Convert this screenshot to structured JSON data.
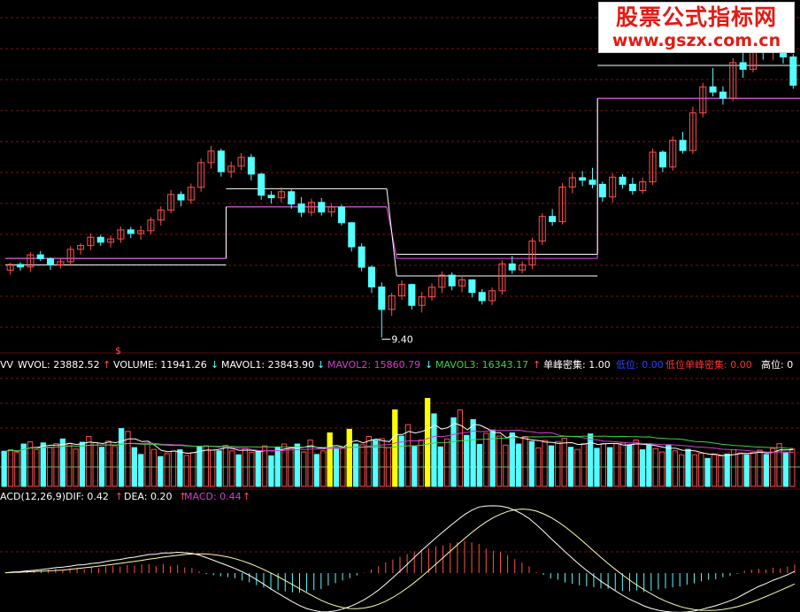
{
  "watermark": {
    "title": "股票公式指标网",
    "url": "www.gszx.com.cn"
  },
  "colors": {
    "up": "#ff5050",
    "down": "#54ffff",
    "grid": "#7a1010",
    "ref": "#cc2020",
    "white": "#ffffff",
    "magenta": "#d040d0",
    "yellow": "#ffff00",
    "green": "#40d040"
  },
  "main_panel": {
    "low_label": "9.40",
    "dollar": "$",
    "bands": [
      {
        "from": 0,
        "to": 21,
        "upper": 12.28,
        "middle": 12.28,
        "lower": 12.04
      },
      {
        "from": 22,
        "to": 37,
        "upper": 14.82,
        "middle": 14.16,
        "lower": 14.16
      },
      {
        "from": 39,
        "to": 58,
        "upper": 12.43,
        "middle": 12.28,
        "lower": 11.64
      },
      {
        "from": 59,
        "to": 80,
        "upper": 19.31,
        "middle": 18.11,
        "lower": 18.11
      },
      {
        "from": 81,
        "to": 89,
        "upper": 17.93,
        "middle": 17.67,
        "lower": 16.6
      }
    ]
  },
  "volume_header": {
    "prefix": "VV",
    "items": [
      {
        "label": "WVOL: 23882.52",
        "arrow": "↑",
        "color": "#ffffff",
        "arrowColor": "#ff5050"
      },
      {
        "label": "VOLUME: 11941.26",
        "arrow": "↓",
        "color": "#ffffff",
        "arrowColor": "#54ffff"
      },
      {
        "label": "MAVOL1: 23843.90",
        "arrow": "↓",
        "color": "#ffffff",
        "arrowColor": "#54ffff"
      },
      {
        "label": "MAVOL2: 15860.79",
        "arrow": "↓",
        "color": "#d040d0",
        "arrowColor": "#54ffff"
      },
      {
        "label": "MAVOL3: 16343.17",
        "arrow": "↑",
        "color": "#40d040",
        "arrowColor": "#ff5050"
      },
      {
        "label": "单峰密集: 1.00",
        "arrow": "",
        "color": "#ffffff",
        "arrowColor": ""
      },
      {
        "label": "低位: 0.00",
        "arrow": "",
        "color": "#3040ff",
        "arrowColor": ""
      },
      {
        "label": "低位单峰密集: 0.00",
        "arrow": "",
        "color": "#ff3030",
        "arrowColor": ""
      },
      {
        "label": "高位: 0",
        "arrow": "",
        "color": "#ffffff",
        "arrowColor": ""
      }
    ]
  },
  "macd_header": {
    "prefix": "ACD(12,26,9)",
    "items": [
      {
        "label": "DIF: 0.42",
        "arrow": "↑",
        "color": "#ffffff",
        "arrowColor": "#ff5050"
      },
      {
        "label": "DEA: 0.20",
        "arrow": "↑",
        "color": "#ffffff",
        "arrowColor": "#ff5050"
      },
      {
        "label": "MACD: 0.44",
        "arrow": "↑",
        "color": "#d040d0",
        "arrowColor": "#ff5050"
      }
    ]
  },
  "chart_data": [
    {
      "type": "candlestick",
      "title": "",
      "price_range": [
        9.0,
        21.5
      ],
      "fields": [
        "open",
        "high",
        "low",
        "close"
      ],
      "ohlc": [
        [
          11.85,
          12.12,
          11.69,
          12.06
        ],
        [
          12.06,
          12.14,
          11.83,
          11.97
        ],
        [
          11.97,
          12.51,
          11.78,
          12.41
        ],
        [
          12.41,
          12.55,
          12.18,
          12.27
        ],
        [
          12.27,
          12.32,
          11.86,
          12.05
        ],
        [
          12.05,
          12.27,
          11.91,
          12.16
        ],
        [
          12.16,
          12.73,
          12.02,
          12.61
        ],
        [
          12.61,
          12.84,
          12.42,
          12.75
        ],
        [
          12.75,
          13.19,
          12.58,
          13.05
        ],
        [
          13.05,
          13.14,
          12.74,
          12.87
        ],
        [
          12.87,
          13.12,
          12.68,
          12.99
        ],
        [
          12.99,
          13.44,
          12.85,
          13.32
        ],
        [
          13.32,
          13.43,
          13.02,
          13.19
        ],
        [
          13.19,
          13.47,
          12.96,
          13.29
        ],
        [
          13.29,
          13.78,
          13.16,
          13.68
        ],
        [
          13.68,
          14.18,
          13.48,
          14.04
        ],
        [
          14.04,
          14.78,
          13.92,
          14.61
        ],
        [
          14.61,
          14.72,
          14.18,
          14.41
        ],
        [
          14.41,
          15.01,
          14.27,
          14.87
        ],
        [
          14.87,
          15.92,
          14.71,
          15.77
        ],
        [
          15.77,
          16.38,
          15.55,
          16.19
        ],
        [
          16.19,
          16.28,
          15.26,
          15.44
        ],
        [
          15.44,
          15.81,
          15.22,
          15.64
        ],
        [
          15.64,
          16.12,
          15.49,
          15.96
        ],
        [
          15.96,
          16.08,
          15.12,
          15.35
        ],
        [
          15.35,
          15.39,
          14.42,
          14.58
        ],
        [
          14.58,
          14.73,
          14.28,
          14.49
        ],
        [
          14.49,
          14.87,
          14.32,
          14.71
        ],
        [
          14.71,
          14.79,
          14.09,
          14.26
        ],
        [
          14.26,
          14.51,
          13.79,
          13.96
        ],
        [
          13.96,
          14.46,
          13.82,
          14.32
        ],
        [
          14.32,
          14.48,
          13.84,
          13.97
        ],
        [
          13.97,
          14.28,
          13.8,
          14.15
        ],
        [
          14.15,
          14.24,
          13.48,
          13.58
        ],
        [
          13.58,
          13.6,
          12.53,
          12.7
        ],
        [
          12.7,
          12.83,
          11.81,
          11.96
        ],
        [
          11.96,
          12.03,
          11.02,
          11.24
        ],
        [
          11.24,
          11.41,
          9.4,
          10.42
        ],
        [
          10.42,
          11.03,
          10.19,
          10.92
        ],
        [
          10.92,
          11.48,
          10.77,
          11.33
        ],
        [
          11.33,
          11.36,
          10.42,
          10.57
        ],
        [
          10.57,
          11.06,
          10.31,
          10.88
        ],
        [
          10.88,
          11.37,
          10.74,
          11.23
        ],
        [
          11.23,
          11.81,
          11.02,
          11.67
        ],
        [
          11.67,
          11.77,
          11.12,
          11.28
        ],
        [
          11.28,
          11.64,
          11.05,
          11.5
        ],
        [
          11.5,
          11.52,
          10.86,
          11.04
        ],
        [
          11.04,
          11.16,
          10.6,
          10.74
        ],
        [
          10.74,
          11.22,
          10.58,
          11.1
        ],
        [
          11.1,
          12.21,
          10.96,
          12.08
        ],
        [
          12.08,
          12.37,
          11.72,
          11.86
        ],
        [
          11.86,
          12.18,
          11.74,
          12.04
        ],
        [
          12.04,
          13.03,
          11.89,
          12.91
        ],
        [
          12.91,
          13.93,
          12.77,
          13.81
        ],
        [
          13.81,
          14.08,
          13.47,
          13.62
        ],
        [
          13.62,
          15.02,
          13.52,
          14.88
        ],
        [
          14.88,
          15.42,
          14.65,
          15.22
        ],
        [
          15.22,
          15.46,
          14.91,
          15.13
        ],
        [
          15.13,
          15.58,
          14.83,
          14.98
        ],
        [
          14.98,
          15.08,
          14.34,
          14.52
        ],
        [
          14.52,
          15.38,
          14.32,
          15.24
        ],
        [
          15.24,
          15.35,
          14.82,
          14.98
        ],
        [
          14.98,
          15.22,
          14.6,
          14.75
        ],
        [
          14.75,
          15.22,
          14.63,
          15.07
        ],
        [
          15.07,
          16.28,
          14.96,
          16.15
        ],
        [
          16.15,
          16.22,
          15.42,
          15.61
        ],
        [
          15.61,
          16.72,
          15.48,
          16.58
        ],
        [
          16.58,
          16.89,
          16.1,
          16.21
        ],
        [
          16.21,
          17.81,
          16.08,
          17.58
        ],
        [
          17.58,
          18.68,
          17.42,
          18.53
        ],
        [
          18.53,
          19.22,
          18.18,
          18.34
        ],
        [
          18.34,
          18.55,
          17.88,
          18.12
        ],
        [
          18.12,
          19.58,
          18.01,
          19.41
        ],
        [
          19.41,
          19.85,
          18.86,
          19.17
        ],
        [
          19.17,
          21.14,
          19.06,
          20.92
        ],
        [
          20.92,
          21.22,
          19.52,
          19.81
        ],
        [
          19.81,
          20.42,
          19.5,
          20.1
        ],
        [
          20.1,
          20.3,
          19.38,
          19.62
        ],
        [
          19.62,
          19.73,
          18.46,
          18.59
        ]
      ]
    },
    {
      "type": "bar",
      "title": "VOL",
      "series": [
        {
          "name": "VOLUME",
          "values": [
            9800,
            10200,
            9600,
            11800,
            12400,
            10300,
            12100,
            10800,
            11900,
            13200,
            12000,
            10400,
            12300,
            13900,
            12200,
            10900,
            12600,
            11300,
            16100,
            15300,
            10800,
            8900,
            11800,
            10300,
            8300,
            9100,
            9800,
            10200,
            8600,
            9400,
            11100,
            11300,
            10100,
            9900,
            11400,
            9900,
            8800,
            10500,
            9500,
            9800,
            11300,
            8500,
            10900,
            11800,
            10700,
            11800,
            9600,
            12900,
            8900,
            9900,
            14900,
            10400,
            10700,
            15900,
            11800,
            11600,
            13900,
            12800,
            13300,
            10800,
            21300,
            14000,
            17200,
            11100,
            12900,
            24500,
            20200,
            11000,
            13200,
            19100,
            21300,
            14200,
            18600,
            11700,
            14800,
            15700,
            14000,
            11500,
            14900,
            11800,
            13900,
            12500,
            10700,
            12800,
            11300,
            12500,
            13400,
            10900,
            10300,
            11900,
            14600,
            10600,
            11900,
            10800,
            11900,
            12100,
            11500,
            12900,
            10200,
            11500,
            10500,
            9600,
            11500,
            9900,
            8800,
            10300,
            8800,
            9200,
            7800,
            8800,
            8500,
            9000,
            10200,
            9300,
            8800,
            9400,
            10100,
            8900,
            10600,
            11900,
            9300,
            10400
          ]
        }
      ]
    },
    {
      "type": "bar",
      "title": "MACD",
      "series": [
        {
          "name": "MACD",
          "values": [
            0.05,
            0.09,
            0.08,
            0.13,
            0.12,
            0.15,
            0.18,
            0.22,
            0.16,
            0.24,
            0.27,
            0.19,
            0.31,
            0.25,
            0.35,
            0.37,
            0.33,
            0.42,
            0.38,
            0.45,
            0.47,
            0.36,
            0.48,
            0.35,
            0.42,
            0.29,
            0.26,
            0.09,
            -0.05,
            -0.11,
            -0.17,
            -0.21,
            -0.26,
            -0.38,
            -0.48,
            -0.62,
            -0.74,
            -0.86,
            -0.88,
            -0.94,
            -0.99,
            -1.01,
            -0.96,
            -0.87,
            -0.82,
            -0.64,
            -0.52,
            -0.38,
            -0.26,
            -0.12,
            0.02,
            0.18,
            0.35,
            0.55,
            0.7,
            0.84,
            0.98,
            1.12,
            1.21,
            1.26,
            1.38,
            1.42,
            1.54,
            1.6,
            1.66,
            1.58,
            1.5,
            1.25,
            1.15,
            1.08,
            0.92,
            0.72,
            0.54,
            0.35,
            0.05,
            -0.09,
            -0.28,
            -0.34,
            -0.48,
            -0.55,
            -0.63,
            -0.68,
            -0.72,
            -0.79,
            -0.81,
            -0.87,
            -0.92,
            -0.94,
            -0.89,
            -0.97,
            -0.91,
            -0.84,
            -0.79,
            -0.73,
            -0.69,
            -0.6,
            -0.53,
            -0.42,
            -0.34,
            -0.32,
            -0.21,
            -0.15,
            -0.04,
            0.13,
            0.18,
            0.22,
            0.19,
            0.28,
            0.24,
            0.33,
            0.44
          ]
        }
      ],
      "legend": [
        "DIF",
        "DEA",
        "MACD"
      ]
    }
  ]
}
